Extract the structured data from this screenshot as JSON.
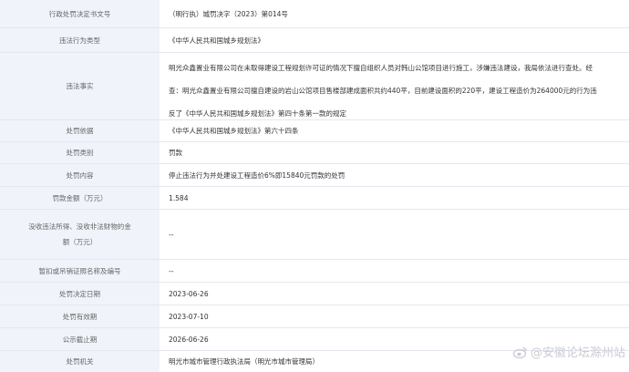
{
  "rows": [
    {
      "label": "行政处罚决定书文号",
      "value": "（明行执）城罚决字（2023）第014号"
    },
    {
      "label": "违法行为类型",
      "value": "《中华人民共和国城乡规划法》"
    },
    {
      "label": "违法事实",
      "lines": [
        "明光众鑫置业有限公司在未取得建设工程规划许可证的情况下擅自组织人员对韩山公馆项目进行施工，涉嫌违法建设，我局依法进行查处。经",
        "查：明光众鑫置业有限公司擅自建设的岩山公馆项目售楼部建成面积共约440平，目前建设面积的220平，建设工程造价为264000元的行为违",
        "反了《中华人民共和国城乡规划法》第四十条第一款的规定"
      ]
    },
    {
      "label": "处罚依据",
      "value": "《中华人民共和国城乡规划法》第六十四条"
    },
    {
      "label": "处罚类别",
      "value": "罚款"
    },
    {
      "label": "处罚内容",
      "value": "停止违法行为并处建设工程造价6%即15840元罚款的处罚"
    },
    {
      "label": "罚款金额（万元）",
      "value": "1.584"
    },
    {
      "label": "没收违法所得、没收非法财物的金额（万元）",
      "value": "--"
    },
    {
      "label": "暂扣或吊销证照名称及编号",
      "value": "--"
    },
    {
      "label": "处罚决定日期",
      "value": "2023-06-26"
    },
    {
      "label": "处罚有效期",
      "value": "2023-07-10"
    },
    {
      "label": "公示截止期",
      "value": "2026-06-26"
    },
    {
      "label": "处罚机关",
      "value": "明光市城市管理行政执法局（明光市城市管理局）"
    }
  ],
  "watermark": "@安徽论坛滁州站",
  "watermark_icon": "weibo-icon"
}
